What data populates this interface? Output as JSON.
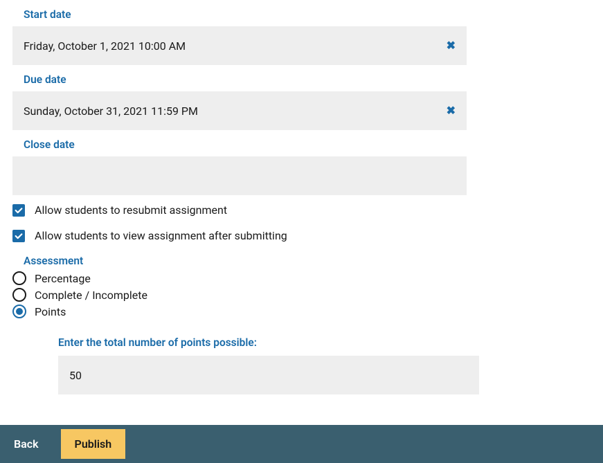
{
  "dates": {
    "start": {
      "label": "Start date",
      "value": "Friday, October 1, 2021 10:00 AM"
    },
    "due": {
      "label": "Due date",
      "value": "Sunday, October 31, 2021 11:59 PM"
    },
    "close": {
      "label": "Close date",
      "value": ""
    }
  },
  "options": {
    "resubmit": {
      "label": "Allow students to resubmit assignment",
      "checked": true
    },
    "view_after_submit": {
      "label": "Allow students to view assignment after submitting",
      "checked": true
    }
  },
  "assessment": {
    "heading": "Assessment",
    "choices": {
      "percentage": {
        "label": "Percentage",
        "selected": false
      },
      "complete": {
        "label": "Complete / Incomplete",
        "selected": false
      },
      "points": {
        "label": "Points",
        "selected": true
      }
    },
    "points_field": {
      "label": "Enter the total number of points possible:",
      "value": "50"
    }
  },
  "footer": {
    "back": "Back",
    "publish": "Publish"
  }
}
